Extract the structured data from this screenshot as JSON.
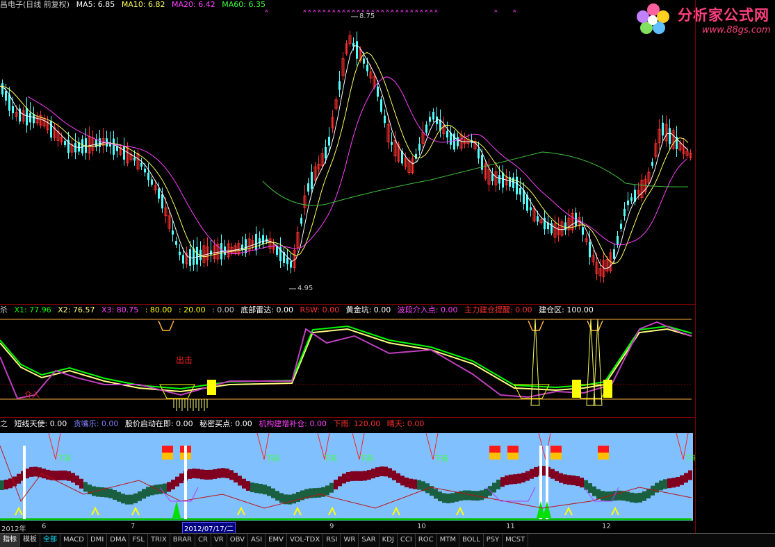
{
  "main": {
    "header": [
      {
        "text": "昌电子(日线 前复权)",
        "color": "#c8c8c8"
      },
      {
        "text": "MA5: 6.85",
        "color": "#ffffff"
      },
      {
        "text": "MA10: 6.82",
        "color": "#ffff60"
      },
      {
        "text": "MA20: 6.42",
        "color": "#ff40ff"
      },
      {
        "text": "MA60: 6.35",
        "color": "#40ff40"
      }
    ],
    "high_label": "8.75",
    "low_label": "4.95"
  },
  "panel2": {
    "header": [
      {
        "text": "杀",
        "color": "#c8c8c8"
      },
      {
        "text": "X1: 77.96",
        "color": "#00ff00"
      },
      {
        "text": "X2: 76.57",
        "color": "#ffff80"
      },
      {
        "text": "X3: 80.75",
        "color": "#ff40ff"
      },
      {
        "text": ": 80.00",
        "color": "#ffff00"
      },
      {
        "text": ": 20.00",
        "color": "#ffff00"
      },
      {
        "text": ": 0.00",
        "color": "#c8c8c8"
      },
      {
        "text": "底部雷达: 0.00",
        "color": "#ffffff"
      },
      {
        "text": "RSW: 0.00",
        "color": "#ff3030"
      },
      {
        "text": "黄金坑: 0.00",
        "color": "#ffffff"
      },
      {
        "text": "波段介入点: 0.00",
        "color": "#ff40ff"
      },
      {
        "text": "主力建仓提醒: 0.00",
        "color": "#ff3030"
      },
      {
        "text": "建仓区: 100.00",
        "color": "#ffffff"
      }
    ],
    "label_out": "出击",
    "label_enter": "介入"
  },
  "panel3": {
    "header": [
      {
        "text": "之",
        "color": "#c8c8c8"
      },
      {
        "text": "短线天使: 0.00",
        "color": "#ffffff"
      },
      {
        "text": "贪嘴乐: 0.00",
        "color": "#8080ff"
      },
      {
        "text": "股价启动在即: 0.00",
        "color": "#ffffff"
      },
      {
        "text": "秘密买点: 0.00",
        "color": "#ffffff"
      },
      {
        "text": "机构建增补仓: 0.00",
        "color": "#ff40ff"
      },
      {
        "text": "下雨: 120.00",
        "color": "#ff3030"
      },
      {
        "text": "晴天: 0.00",
        "color": "#ff3030"
      }
    ],
    "rain_label": "下雨"
  },
  "dates": {
    "year": "2012年",
    "months": [
      "6",
      "7",
      "9",
      "10",
      "11",
      "12"
    ],
    "selected": "2012/07/17/二"
  },
  "tabs": [
    "指标",
    "模板",
    "全部",
    "MACD",
    "DMI",
    "DMA",
    "FSL",
    "TRIX",
    "BRAR",
    "CR",
    "VR",
    "OBV",
    "ASI",
    "EMV",
    "VOL-TDX",
    "RSI",
    "WR",
    "SAR",
    "KDJ",
    "CCI",
    "ROC",
    "MTM",
    "BOLL",
    "PSY",
    "MCST"
  ],
  "logo": {
    "title": "分析家公式网",
    "url": "www.88gs.com"
  },
  "colors": {
    "up": "#ff3030",
    "down": "#54ffff",
    "panel3_bg": "#80c0ff"
  }
}
